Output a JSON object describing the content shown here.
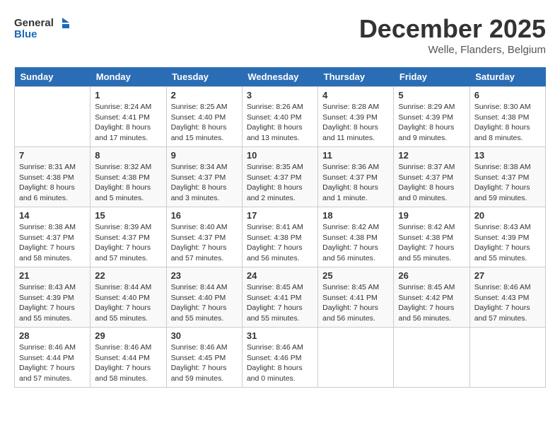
{
  "header": {
    "logo_line1": "General",
    "logo_line2": "Blue",
    "month": "December 2025",
    "location": "Welle, Flanders, Belgium"
  },
  "days_of_week": [
    "Sunday",
    "Monday",
    "Tuesday",
    "Wednesday",
    "Thursday",
    "Friday",
    "Saturday"
  ],
  "weeks": [
    [
      {
        "day": "",
        "info": ""
      },
      {
        "day": "1",
        "info": "Sunrise: 8:24 AM\nSunset: 4:41 PM\nDaylight: 8 hours\nand 17 minutes."
      },
      {
        "day": "2",
        "info": "Sunrise: 8:25 AM\nSunset: 4:40 PM\nDaylight: 8 hours\nand 15 minutes."
      },
      {
        "day": "3",
        "info": "Sunrise: 8:26 AM\nSunset: 4:40 PM\nDaylight: 8 hours\nand 13 minutes."
      },
      {
        "day": "4",
        "info": "Sunrise: 8:28 AM\nSunset: 4:39 PM\nDaylight: 8 hours\nand 11 minutes."
      },
      {
        "day": "5",
        "info": "Sunrise: 8:29 AM\nSunset: 4:39 PM\nDaylight: 8 hours\nand 9 minutes."
      },
      {
        "day": "6",
        "info": "Sunrise: 8:30 AM\nSunset: 4:38 PM\nDaylight: 8 hours\nand 8 minutes."
      }
    ],
    [
      {
        "day": "7",
        "info": "Sunrise: 8:31 AM\nSunset: 4:38 PM\nDaylight: 8 hours\nand 6 minutes."
      },
      {
        "day": "8",
        "info": "Sunrise: 8:32 AM\nSunset: 4:38 PM\nDaylight: 8 hours\nand 5 minutes."
      },
      {
        "day": "9",
        "info": "Sunrise: 8:34 AM\nSunset: 4:37 PM\nDaylight: 8 hours\nand 3 minutes."
      },
      {
        "day": "10",
        "info": "Sunrise: 8:35 AM\nSunset: 4:37 PM\nDaylight: 8 hours\nand 2 minutes."
      },
      {
        "day": "11",
        "info": "Sunrise: 8:36 AM\nSunset: 4:37 PM\nDaylight: 8 hours\nand 1 minute."
      },
      {
        "day": "12",
        "info": "Sunrise: 8:37 AM\nSunset: 4:37 PM\nDaylight: 8 hours\nand 0 minutes."
      },
      {
        "day": "13",
        "info": "Sunrise: 8:38 AM\nSunset: 4:37 PM\nDaylight: 7 hours\nand 59 minutes."
      }
    ],
    [
      {
        "day": "14",
        "info": "Sunrise: 8:38 AM\nSunset: 4:37 PM\nDaylight: 7 hours\nand 58 minutes."
      },
      {
        "day": "15",
        "info": "Sunrise: 8:39 AM\nSunset: 4:37 PM\nDaylight: 7 hours\nand 57 minutes."
      },
      {
        "day": "16",
        "info": "Sunrise: 8:40 AM\nSunset: 4:37 PM\nDaylight: 7 hours\nand 57 minutes."
      },
      {
        "day": "17",
        "info": "Sunrise: 8:41 AM\nSunset: 4:38 PM\nDaylight: 7 hours\nand 56 minutes."
      },
      {
        "day": "18",
        "info": "Sunrise: 8:42 AM\nSunset: 4:38 PM\nDaylight: 7 hours\nand 56 minutes."
      },
      {
        "day": "19",
        "info": "Sunrise: 8:42 AM\nSunset: 4:38 PM\nDaylight: 7 hours\nand 55 minutes."
      },
      {
        "day": "20",
        "info": "Sunrise: 8:43 AM\nSunset: 4:39 PM\nDaylight: 7 hours\nand 55 minutes."
      }
    ],
    [
      {
        "day": "21",
        "info": "Sunrise: 8:43 AM\nSunset: 4:39 PM\nDaylight: 7 hours\nand 55 minutes."
      },
      {
        "day": "22",
        "info": "Sunrise: 8:44 AM\nSunset: 4:40 PM\nDaylight: 7 hours\nand 55 minutes."
      },
      {
        "day": "23",
        "info": "Sunrise: 8:44 AM\nSunset: 4:40 PM\nDaylight: 7 hours\nand 55 minutes."
      },
      {
        "day": "24",
        "info": "Sunrise: 8:45 AM\nSunset: 4:41 PM\nDaylight: 7 hours\nand 55 minutes."
      },
      {
        "day": "25",
        "info": "Sunrise: 8:45 AM\nSunset: 4:41 PM\nDaylight: 7 hours\nand 56 minutes."
      },
      {
        "day": "26",
        "info": "Sunrise: 8:45 AM\nSunset: 4:42 PM\nDaylight: 7 hours\nand 56 minutes."
      },
      {
        "day": "27",
        "info": "Sunrise: 8:46 AM\nSunset: 4:43 PM\nDaylight: 7 hours\nand 57 minutes."
      }
    ],
    [
      {
        "day": "28",
        "info": "Sunrise: 8:46 AM\nSunset: 4:44 PM\nDaylight: 7 hours\nand 57 minutes."
      },
      {
        "day": "29",
        "info": "Sunrise: 8:46 AM\nSunset: 4:44 PM\nDaylight: 7 hours\nand 58 minutes."
      },
      {
        "day": "30",
        "info": "Sunrise: 8:46 AM\nSunset: 4:45 PM\nDaylight: 7 hours\nand 59 minutes."
      },
      {
        "day": "31",
        "info": "Sunrise: 8:46 AM\nSunset: 4:46 PM\nDaylight: 8 hours\nand 0 minutes."
      },
      {
        "day": "",
        "info": ""
      },
      {
        "day": "",
        "info": ""
      },
      {
        "day": "",
        "info": ""
      }
    ]
  ]
}
